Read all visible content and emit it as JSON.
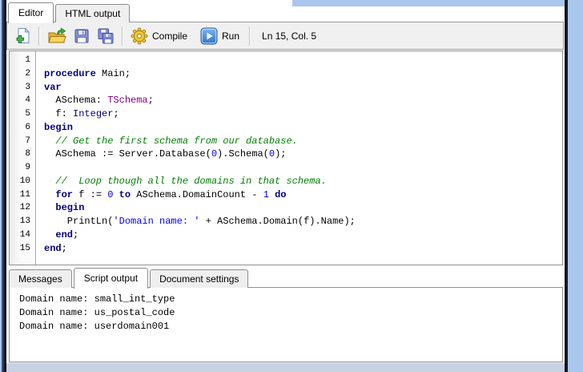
{
  "top_tabs": [
    {
      "label": "Editor",
      "active": true
    },
    {
      "label": "HTML output",
      "active": false
    }
  ],
  "toolbar": {
    "buttons": [
      {
        "name": "new-document"
      },
      {
        "name": "open"
      },
      {
        "name": "save"
      },
      {
        "name": "save-all"
      }
    ],
    "compile_label": "Compile",
    "run_label": "Run",
    "status": "Ln 15, Col. 5"
  },
  "editor": {
    "lines": [
      {
        "num": "1",
        "segs": []
      },
      {
        "num": "2",
        "segs": [
          {
            "c": "kw",
            "t": "procedure"
          },
          {
            "c": "pl",
            "t": " Main;"
          }
        ]
      },
      {
        "num": "3",
        "segs": [
          {
            "c": "kw",
            "t": "var"
          }
        ]
      },
      {
        "num": "4",
        "segs": [
          {
            "c": "pl",
            "t": "  ASchema: "
          },
          {
            "c": "ty",
            "t": "TSchema"
          },
          {
            "c": "pl",
            "t": ";"
          }
        ]
      },
      {
        "num": "5",
        "segs": [
          {
            "c": "pl",
            "t": "  f: "
          },
          {
            "c": "bt",
            "t": "Integer"
          },
          {
            "c": "pl",
            "t": ";"
          }
        ]
      },
      {
        "num": "6",
        "segs": [
          {
            "c": "kw",
            "t": "begin"
          }
        ]
      },
      {
        "num": "7",
        "segs": [
          {
            "c": "cm",
            "t": "  // Get the first schema from our database."
          }
        ]
      },
      {
        "num": "8",
        "segs": [
          {
            "c": "pl",
            "t": "  ASchema := Server.Database("
          },
          {
            "c": "nu",
            "t": "0"
          },
          {
            "c": "pl",
            "t": ").Schema("
          },
          {
            "c": "nu",
            "t": "0"
          },
          {
            "c": "pl",
            "t": ");"
          }
        ]
      },
      {
        "num": "9",
        "segs": []
      },
      {
        "num": "10",
        "segs": [
          {
            "c": "cm",
            "t": "  //  Loop though all the domains in that schema."
          }
        ]
      },
      {
        "num": "11",
        "segs": [
          {
            "c": "pl",
            "t": "  "
          },
          {
            "c": "kw",
            "t": "for"
          },
          {
            "c": "pl",
            "t": " f := "
          },
          {
            "c": "nu",
            "t": "0"
          },
          {
            "c": "kw",
            "t": " to "
          },
          {
            "c": "pl",
            "t": "ASchema.DomainCount - "
          },
          {
            "c": "nu",
            "t": "1"
          },
          {
            "c": "kw",
            "t": " do"
          }
        ]
      },
      {
        "num": "12",
        "segs": [
          {
            "c": "pl",
            "t": "  "
          },
          {
            "c": "kw",
            "t": "begin"
          }
        ]
      },
      {
        "num": "13",
        "segs": [
          {
            "c": "pl",
            "t": "    PrintLn("
          },
          {
            "c": "st",
            "t": "'Domain name: '"
          },
          {
            "c": "pl",
            "t": " + ASchema.Domain(f).Name);"
          }
        ]
      },
      {
        "num": "14",
        "segs": [
          {
            "c": "pl",
            "t": "  "
          },
          {
            "c": "kw",
            "t": "end"
          },
          {
            "c": "pl",
            "t": ";"
          }
        ]
      },
      {
        "num": "15",
        "segs": [
          {
            "c": "kw",
            "t": "end"
          },
          {
            "c": "pl",
            "t": ";"
          }
        ]
      }
    ]
  },
  "bottom_tabs": [
    {
      "label": "Messages",
      "active": false
    },
    {
      "label": "Script output",
      "active": true
    },
    {
      "label": "Document settings",
      "active": false
    }
  ],
  "output": {
    "lines": [
      "Domain name: small_int_type",
      "Domain name: us_postal_code",
      "Domain name: userdomain001"
    ]
  },
  "syntax_colors": {
    "keyword": "#000080",
    "user_type": "#800080",
    "builtin_type": "#000080",
    "string": "#0000FF",
    "number": "#0000FF",
    "comment": "#008000",
    "plain": "#000000"
  },
  "ui_colors": {
    "toolbar_bg": "#F0F0F0",
    "panel_border": "#919191",
    "window_edge_blue": "#A9C6EC",
    "window_edge_dark": "#16181D"
  }
}
